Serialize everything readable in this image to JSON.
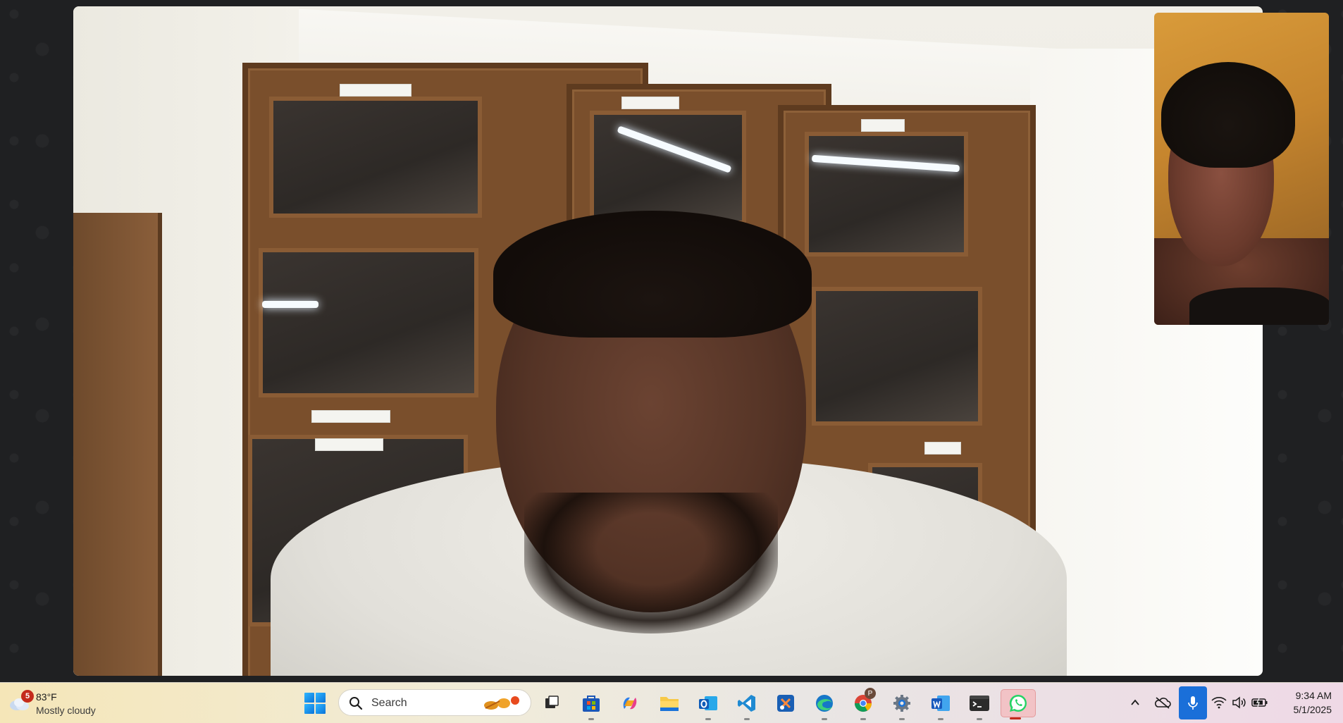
{
  "call": {
    "remote_video_label": "",
    "self_preview_label": ""
  },
  "weather": {
    "badge_count": "5",
    "temperature": "83°F",
    "condition": "Mostly cloudy",
    "icon": "cloudy-weather-icon"
  },
  "search": {
    "label": "Search"
  },
  "taskbar_apps": [
    {
      "name": "task-view",
      "icon": "task-view-icon"
    },
    {
      "name": "microsoft-store",
      "icon": "store-icon"
    },
    {
      "name": "copilot",
      "icon": "copilot-icon"
    },
    {
      "name": "file-explorer",
      "icon": "folder-icon"
    },
    {
      "name": "outlook",
      "icon": "outlook-icon"
    },
    {
      "name": "vscode",
      "icon": "vscode-icon"
    },
    {
      "name": "snipping-tool",
      "icon": "snip-icon"
    },
    {
      "name": "edge",
      "icon": "edge-icon"
    },
    {
      "name": "chrome",
      "icon": "chrome-icon",
      "profile_badge": "P"
    },
    {
      "name": "settings",
      "icon": "gear-icon"
    },
    {
      "name": "word",
      "icon": "word-icon"
    },
    {
      "name": "terminal",
      "icon": "terminal-icon"
    },
    {
      "name": "whatsapp",
      "icon": "whatsapp-icon",
      "active": true
    }
  ],
  "tray": {
    "icons": [
      "chevron-up-icon",
      "onedrive-offline-icon",
      "microphone-icon",
      "wifi-icon",
      "speaker-icon",
      "battery-icon"
    ]
  },
  "clock": {
    "time": "9:34 AM",
    "date": "5/1/2025"
  },
  "colors": {
    "accent": "#1a6fd9",
    "whatsapp_green": "#25d366",
    "badge_red": "#c42b1c"
  }
}
